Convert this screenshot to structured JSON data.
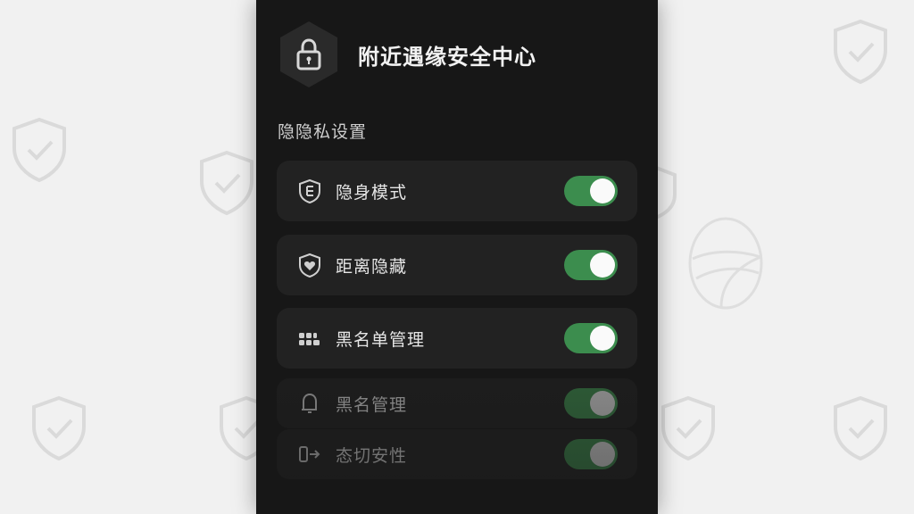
{
  "header": {
    "title": "附近遇缘安全中心",
    "icon": "lock-icon"
  },
  "section": {
    "label": "隐隐私设置"
  },
  "settings": [
    {
      "label": "隐身模式",
      "icon": "shield-e-icon",
      "enabled": true
    },
    {
      "label": "距离隐藏",
      "icon": "shield-heart-icon",
      "enabled": true
    },
    {
      "label": "黑名单管理",
      "icon": "blocks-icon",
      "enabled": true
    },
    {
      "label": "黑名管理",
      "icon": "bell-icon",
      "enabled": true
    },
    {
      "label": "态切安性",
      "icon": "logout-icon",
      "enabled": true
    }
  ],
  "colors": {
    "panel": "#171717",
    "toggle_on": "#3c8d4e",
    "background": "#f1f1f1"
  }
}
